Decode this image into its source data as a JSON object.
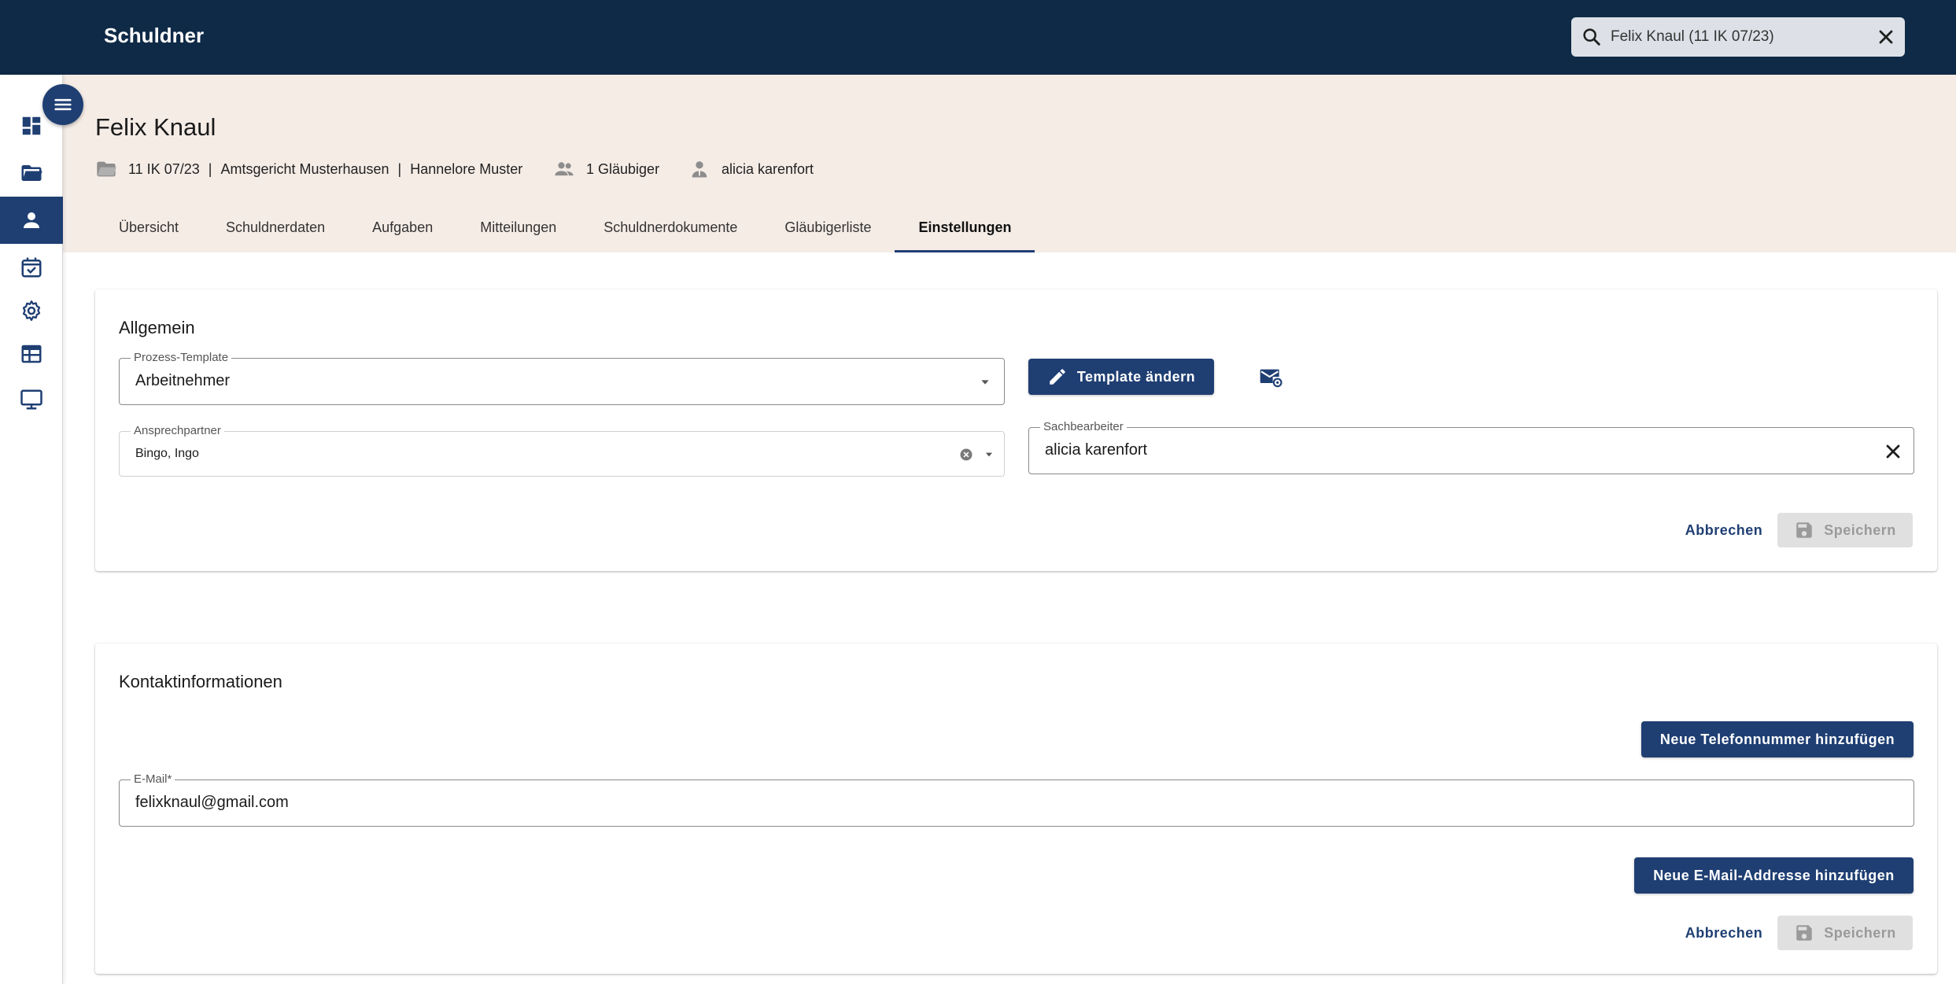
{
  "app": {
    "title": "Schuldner"
  },
  "search": {
    "value": "Felix Knaul (11 IK 07/23)",
    "icon": "search-icon",
    "clear_icon": "close-icon"
  },
  "sidebar": {
    "menu_icon": "menu-icon",
    "items": [
      {
        "icon": "dashboard-icon",
        "active": false
      },
      {
        "icon": "folder-open-icon",
        "active": false
      },
      {
        "icon": "person-icon",
        "active": true
      },
      {
        "icon": "calendar-check-icon",
        "active": false
      },
      {
        "icon": "gear-icon",
        "active": false
      },
      {
        "icon": "table-icon",
        "active": false
      },
      {
        "icon": "monitor-icon",
        "active": false
      }
    ]
  },
  "header": {
    "name": "Felix Knaul",
    "case_number": "11 IK 07/23",
    "separator": "|",
    "court": "Amtsgericht Musterhausen",
    "officer": "Hannelore Muster",
    "creditors": "1 Gläubiger",
    "agent": "alicia karenfort"
  },
  "tabs": [
    {
      "label": "Übersicht",
      "active": false
    },
    {
      "label": "Schuldnerdaten",
      "active": false
    },
    {
      "label": "Aufgaben",
      "active": false
    },
    {
      "label": "Mitteilungen",
      "active": false
    },
    {
      "label": "Schuldnerdokumente",
      "active": false
    },
    {
      "label": "Gläubigerliste",
      "active": false
    },
    {
      "label": "Einstellungen",
      "active": true
    }
  ],
  "general": {
    "title": "Allgemein",
    "process_template": {
      "label": "Prozess-Template",
      "value": "Arbeitnehmer"
    },
    "change_template_label": "Template ändern",
    "contact_person": {
      "label": "Ansprechpartner",
      "value": "Bingo, Ingo"
    },
    "clerk": {
      "label": "Sachbearbeiter",
      "value": "alicia karenfort"
    },
    "cancel_label": "Abbrechen",
    "save_label": "Speichern"
  },
  "contact": {
    "title": "Kontaktinformationen",
    "add_phone_label": "Neue Telefonnummer hinzufügen",
    "email": {
      "label": "E-Mail*",
      "value": "felixknaul@gmail.com"
    },
    "add_email_label": "Neue E-Mail-Addresse hinzufügen",
    "cancel_label": "Abbrechen",
    "save_label": "Speichern"
  },
  "colors": {
    "topbar": "#0f2a47",
    "primary": "#1f3f73",
    "header_bg": "#f5ece6",
    "icon": "#1f3f73"
  }
}
